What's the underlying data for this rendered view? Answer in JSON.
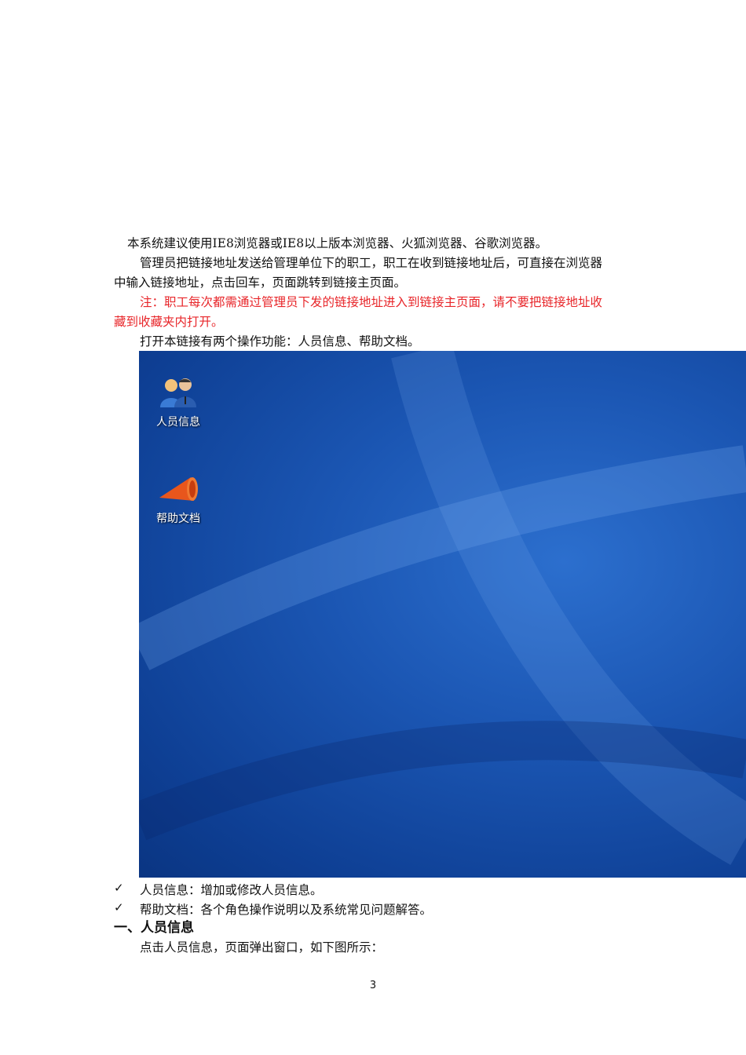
{
  "paragraphs": {
    "p1": "本系统建议使用IE8浏览器或IE8以上版本浏览器、火狐浏览器、谷歌浏览器。",
    "p2_line1": "管理员把链接地址发送给管理单位下的职工，职工在收到链接地址后，可直接在浏览器",
    "p2_line2": "中输入链接地址，点击回车，页面跳转到链接主页面。",
    "note_line1": "注：职工每次都需通过管理员下发的链接地址进入到链接主页面，请不要把链接地址收",
    "note_line2": "藏到收藏夹内打开。",
    "p3": "打开本链接有两个操作功能：人员信息、帮助文档。"
  },
  "desktop": {
    "icons": [
      {
        "label": "人员信息",
        "icon": "users-icon"
      },
      {
        "label": "帮助文档",
        "icon": "megaphone-icon"
      }
    ]
  },
  "bullets": [
    {
      "mark": "✓",
      "text": "人员信息：增加或修改人员信息。"
    },
    {
      "mark": "✓",
      "text": "帮助文档：各个角色操作说明以及系统常见问题解答。"
    }
  ],
  "section_heading": "一、人员信息",
  "p4": "点击人员信息，页面弹出窗口，如下图所示：",
  "page_number": "3",
  "colors": {
    "note": "#e8262a",
    "desktop": "#1b56b3"
  }
}
